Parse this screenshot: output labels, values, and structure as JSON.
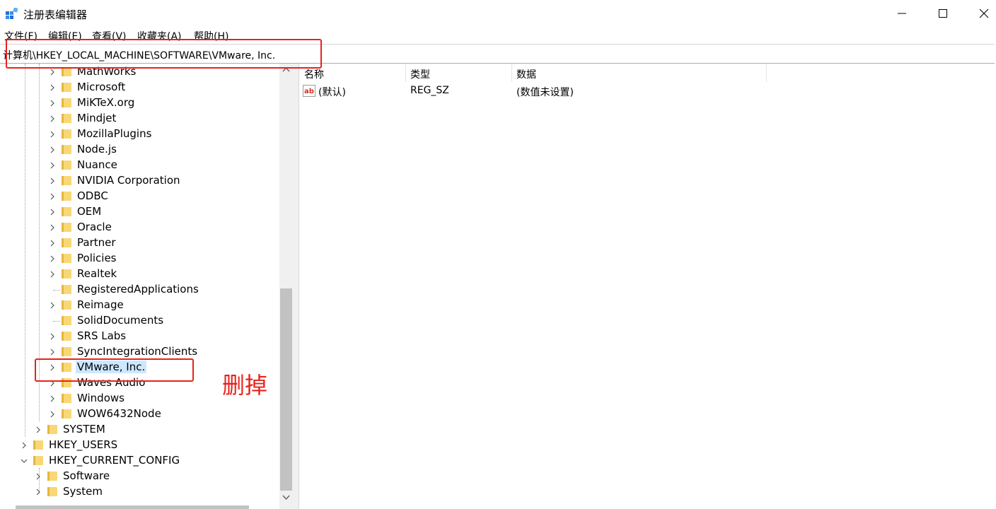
{
  "window": {
    "title": "注册表编辑器",
    "icon": "registry-editor-icon",
    "controls": [
      "minimize-icon",
      "maximize-icon",
      "close-icon"
    ]
  },
  "menu": [
    {
      "label": "文件(F)"
    },
    {
      "label": "编辑(E)"
    },
    {
      "label": "查看(V)"
    },
    {
      "label": "收藏夹(A)"
    },
    {
      "label": "帮助(H)"
    }
  ],
  "address": "计算机\\HKEY_LOCAL_MACHINE\\SOFTWARE\\VMware, Inc.",
  "tree": [
    {
      "label": "MathWorks",
      "expandable": true
    },
    {
      "label": "Microsoft",
      "expandable": true
    },
    {
      "label": "MiKTeX.org",
      "expandable": true
    },
    {
      "label": "Mindjet",
      "expandable": true
    },
    {
      "label": "MozillaPlugins",
      "expandable": true
    },
    {
      "label": "Node.js",
      "expandable": true
    },
    {
      "label": "Nuance",
      "expandable": true
    },
    {
      "label": "NVIDIA Corporation",
      "expandable": true
    },
    {
      "label": "ODBC",
      "expandable": true
    },
    {
      "label": "OEM",
      "expandable": true
    },
    {
      "label": "Oracle",
      "expandable": true
    },
    {
      "label": "Partner",
      "expandable": true
    },
    {
      "label": "Policies",
      "expandable": true
    },
    {
      "label": "Realtek",
      "expandable": true
    },
    {
      "label": "RegisteredApplications",
      "expandable": false
    },
    {
      "label": "Reimage",
      "expandable": true
    },
    {
      "label": "SolidDocuments",
      "expandable": false
    },
    {
      "label": "SRS Labs",
      "expandable": true
    },
    {
      "label": "SyncIntegrationClients",
      "expandable": true
    },
    {
      "label": "VMware, Inc.",
      "expandable": true,
      "selected": true
    },
    {
      "label": "Waves Audio",
      "expandable": true
    },
    {
      "label": "Windows",
      "expandable": true
    },
    {
      "label": "WOW6432Node",
      "expandable": true
    },
    {
      "label": "SYSTEM",
      "expandable": true
    },
    {
      "label": "HKEY_USERS",
      "expandable": true
    },
    {
      "label": "HKEY_CURRENT_CONFIG",
      "expandable": true,
      "expanded": true
    },
    {
      "label": "Software",
      "expandable": true
    },
    {
      "label": "System",
      "expandable": true
    }
  ],
  "list": {
    "columns": [
      "名称",
      "类型",
      "数据"
    ],
    "rows": [
      {
        "name": "(默认)",
        "type": "REG_SZ",
        "data": "(数值未设置)",
        "icon": "string-value-ab-icon"
      }
    ]
  },
  "annotation": {
    "text": "删掉",
    "color": "#e8221b"
  },
  "colors": {
    "selection": "#cce8ff",
    "folder": "#f8d775",
    "annotation": "#e8221b"
  }
}
